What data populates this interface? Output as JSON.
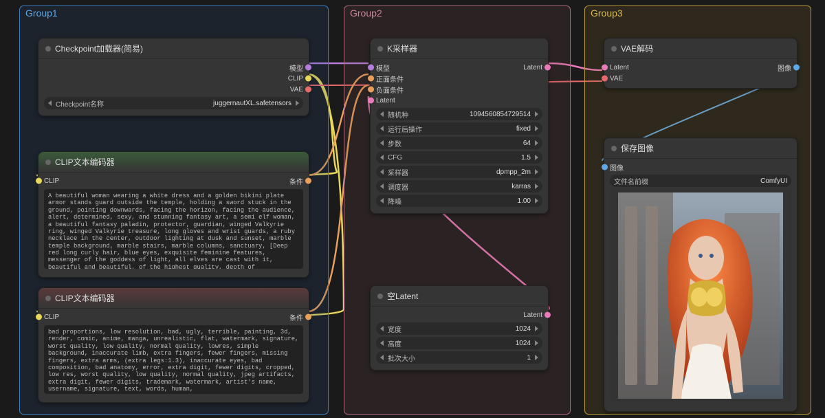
{
  "groups": {
    "g1": "Group1",
    "g2": "Group2",
    "g3": "Group3"
  },
  "checkpoint": {
    "title": "Checkpoint加载器(简易)",
    "out_model": "模型",
    "out_clip": "CLIP",
    "out_vae": "VAE",
    "widget_label": "Checkpoint名称",
    "widget_value": "juggernautXL.safetensors"
  },
  "clip_pos": {
    "title": "CLIP文本编码器",
    "in_clip": "CLIP",
    "out_cond": "条件",
    "text": "A beautiful woman wearing a white dress and a golden bikini plate armor stands guard outside the temple, holding a sword stuck in the ground, pointing downwards, facing the horizon, facing the audience, alert, determined, sexy, and stunning fantasy art, a semi elf woman, a beautiful fantasy paladin, protector, guardian, winged Valkyrie ring, winged Valkyrie treasure, long gloves and wrist guards, a ruby necklace in the center, outdoor lighting at dusk and sunset, marble temple background, marble stairs, marble columns, sanctuary, [Deep red long curly hair, blue eyes, exquisite feminine features, messenger of the goddess of light, all elves are cast with it, beautiful and beautiful, of the highest quality, depth of"
  },
  "clip_neg": {
    "title": "CLIP文本编码器",
    "in_clip": "CLIP",
    "out_cond": "条件",
    "text": "bad proportions, low resolution, bad, ugly, terrible, painting, 3d, render, comic, anime, manga, unrealistic, flat, watermark, signature, worst quality, low quality, normal quality, lowres, simple background, inaccurate limb, extra fingers, fewer fingers, missing fingers, extra arms, (extra legs:1.3), inaccurate eyes, bad composition, bad anatomy, error, extra digit, fewer digits, cropped, low res, worst quality, low quality, normal quality, jpeg artifacts, extra digit, fewer digits, trademark, watermark, artist's name, username, signature, text, words, human,"
  },
  "ksampler": {
    "title": "K采样器",
    "in_model": "模型",
    "in_pos": "正面条件",
    "in_neg": "负面条件",
    "in_latent": "Latent",
    "out_latent": "Latent",
    "widgets": [
      {
        "label": "随机种",
        "value": "1094560854729514"
      },
      {
        "label": "运行后操作",
        "value": "fixed"
      },
      {
        "label": "步数",
        "value": "64"
      },
      {
        "label": "CFG",
        "value": "1.5"
      },
      {
        "label": "采样器",
        "value": "dpmpp_2m"
      },
      {
        "label": "调度器",
        "value": "karras"
      },
      {
        "label": "降噪",
        "value": "1.00"
      }
    ]
  },
  "empty_latent": {
    "title": "空Latent",
    "out_latent": "Latent",
    "widgets": [
      {
        "label": "宽度",
        "value": "1024"
      },
      {
        "label": "高度",
        "value": "1024"
      },
      {
        "label": "批次大小",
        "value": "1"
      }
    ]
  },
  "vae_decode": {
    "title": "VAE解码",
    "in_latent": "Latent",
    "in_vae": "VAE",
    "out_image": "图像"
  },
  "save_image": {
    "title": "保存图像",
    "in_image": "图像",
    "widget_label": "文件名前缀",
    "widget_value": "ComfyUI"
  }
}
